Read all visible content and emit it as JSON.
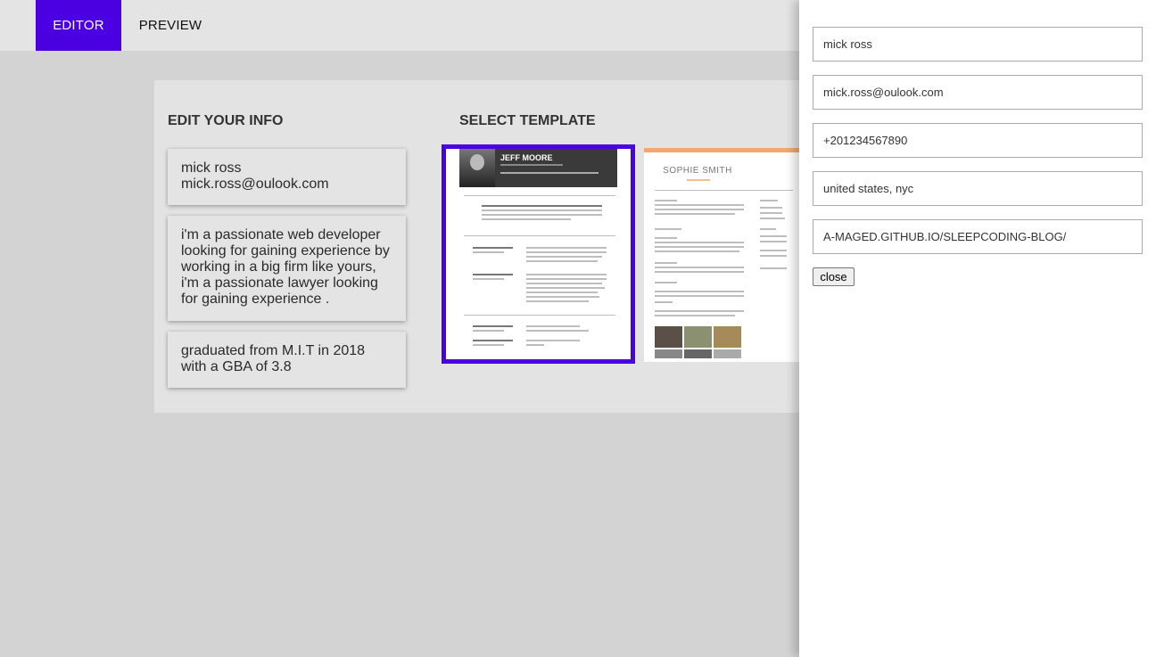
{
  "nav": {
    "editor_label": "EDITOR",
    "preview_label": "PREVIEW",
    "accent": "#4a00e0"
  },
  "editor": {
    "title": "EDIT YOUR INFO",
    "cards": [
      {
        "lines": [
          "mick ross",
          "mick.ross@oulook.com"
        ]
      },
      {
        "text": "i'm a passionate web developer looking for gaining experience by working in a big firm like yours, i'm a passionate lawyer looking for gaining experience ."
      },
      {
        "text": "graduated from M.I.T in 2018 with a GBA of 3.8"
      }
    ]
  },
  "templates": {
    "title": "SELECT TEMPLATE",
    "items": [
      {
        "name": "JEFF MOORE",
        "selected": true
      },
      {
        "name": "SOPHIE SMITH",
        "selected": false
      }
    ]
  },
  "form": {
    "name": "mick ross",
    "email": "mick.ross@oulook.com",
    "phone": "+201234567890",
    "location": "united states, nyc",
    "website": "A-MAGED.GITHUB.IO/SLEEPCODING-BLOG/",
    "close_label": "close"
  }
}
